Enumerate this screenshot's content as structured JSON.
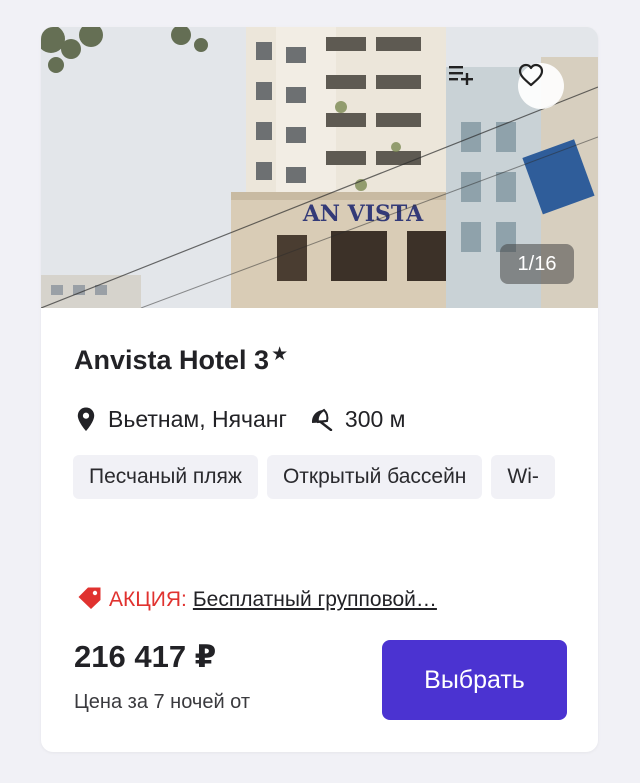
{
  "hotel": {
    "name": "Anvista Hotel 3",
    "stars_symbol": "★",
    "photo_sign": "AN VISTA",
    "photo_counter": "1/16",
    "location": "Вьетнам, Нячанг",
    "beach_distance": "300 м",
    "amenities": [
      "Песчаный пляж",
      "Открытый бассейн",
      "Wi-"
    ]
  },
  "promo": {
    "label": "АКЦИЯ:",
    "text": "Бесплатный групповой…"
  },
  "price": {
    "amount": "216 417 ₽",
    "note": "Цена за 7 ночей от"
  },
  "actions": {
    "select_label": "Выбрать"
  },
  "icons": {
    "playlist": "playlist-add-icon",
    "favorite": "heart-icon",
    "location": "location-pin-icon",
    "beach": "beach-umbrella-icon",
    "promo": "price-tag-icon"
  },
  "colors": {
    "accent": "#4b33d1",
    "promo": "#e0322f",
    "background": "#f1f1f6"
  }
}
